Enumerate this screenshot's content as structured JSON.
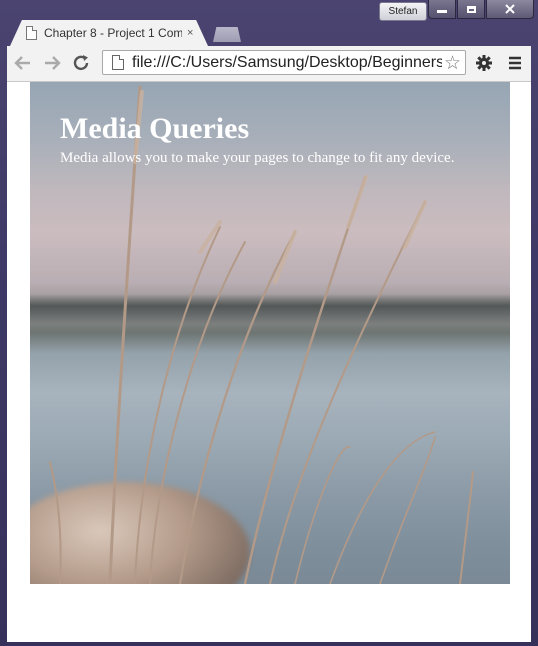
{
  "window": {
    "user_label": "Stefan",
    "buttons": [
      "minimize",
      "maximize",
      "close"
    ]
  },
  "tabs": [
    {
      "title": "Chapter 8 - Project 1 Com",
      "close_glyph": "×",
      "icon": "page-icon"
    }
  ],
  "toolbar": {
    "back_glyph": "←",
    "forward_glyph": "→",
    "reload_glyph": "↻",
    "url": "file:///C:/Users/Samsung/Desktop/Beginners",
    "star_glyph": "☆",
    "settings_glyph": "⚙",
    "menu_glyph": "≡"
  },
  "page": {
    "heading": "Media Queries",
    "subheading": "Media allows you to make your pages to change to fit any device."
  }
}
